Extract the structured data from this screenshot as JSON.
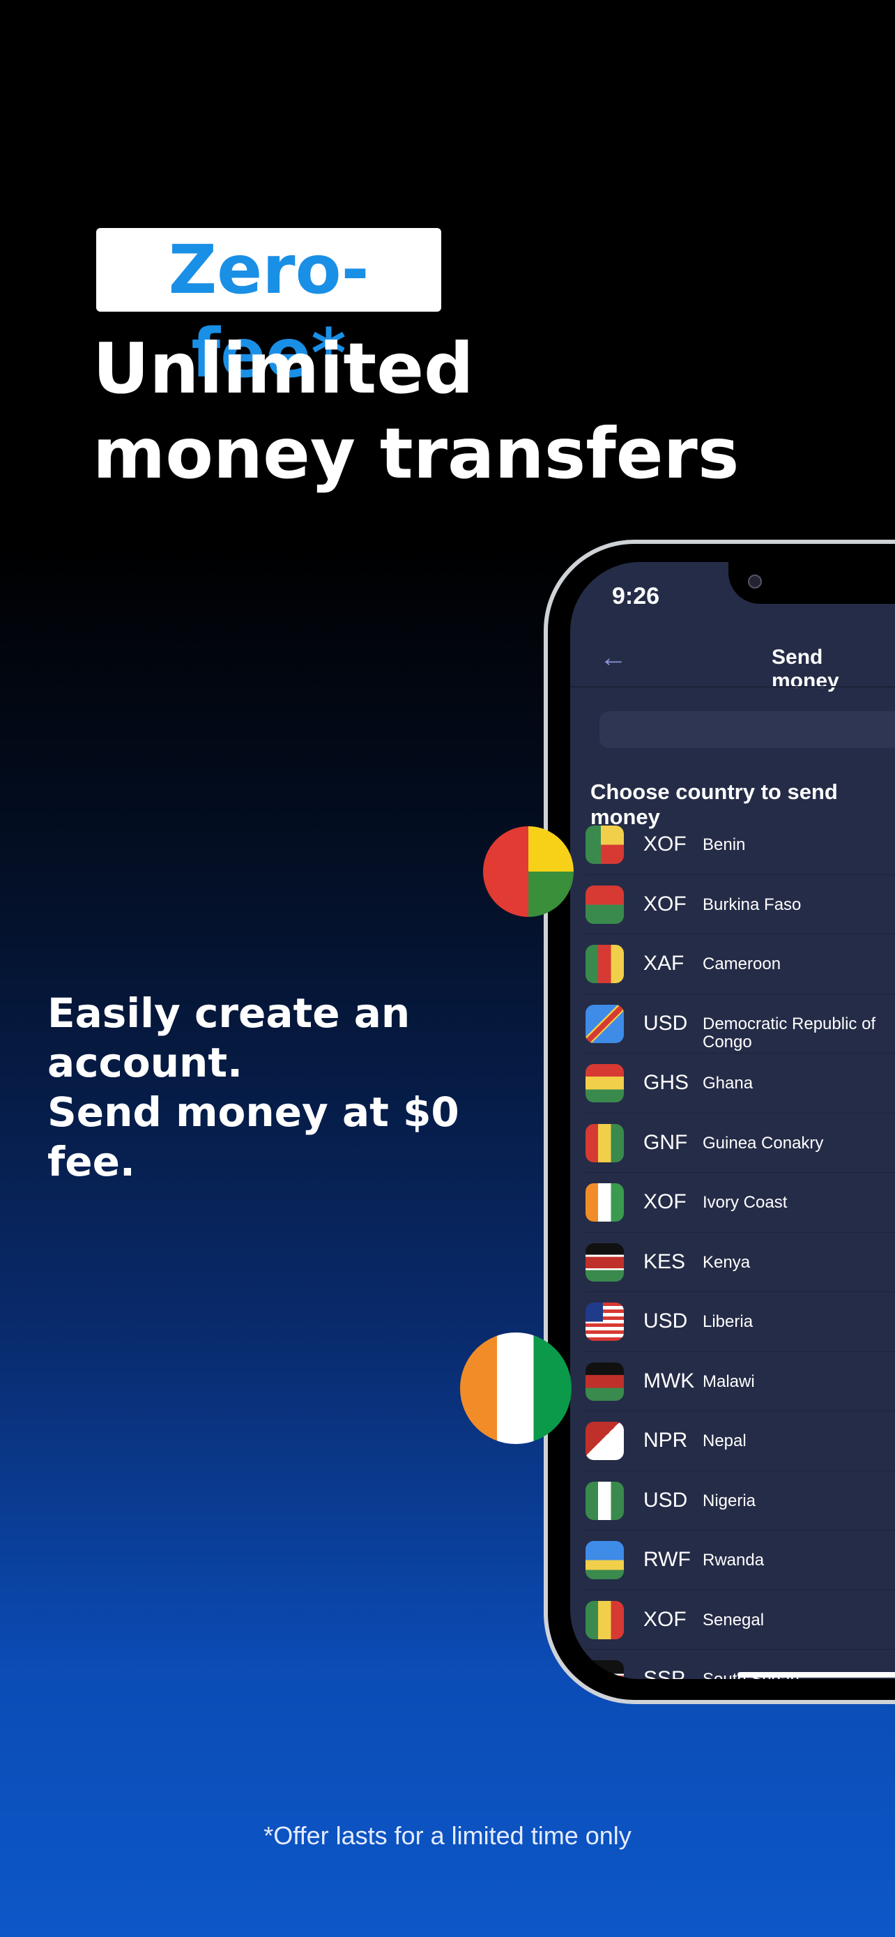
{
  "promo": {
    "badge": "Zero-fee*",
    "headline_line1": "Unlimited",
    "headline_line2": "money transfers",
    "sub_line1": "Easily create an",
    "sub_line2": "account.",
    "sub_line3": "Send money at $0 fee.",
    "footer": "*Offer lasts for a limited time only"
  },
  "phone": {
    "time": "9:26",
    "title": "Send money",
    "back_icon": "arrow-left-icon",
    "search_placeholder": "",
    "section_title": "Choose country to send money",
    "countries": [
      {
        "currency": "XOF",
        "name": "Benin",
        "flag": "linear-gradient(90deg,#3a8a4e 0 40%,transparent 40%),linear-gradient(180deg,#f2cf4a 0 50%,#d63a33 50%)"
      },
      {
        "currency": "XOF",
        "name": "Burkina Faso",
        "flag": "linear-gradient(180deg,#d63a33 0 50%,#3a8a4e 50%)"
      },
      {
        "currency": "XAF",
        "name": "Cameroon",
        "flag": "linear-gradient(90deg,#3a8a4e 0 33%,#d63a33 33% 66%,#f2cf4a 66%)"
      },
      {
        "currency": "USD",
        "name": "Democratic Republic of Congo",
        "flag": "linear-gradient(135deg,#3e8be8 0 42%,#f2cf4a 42% 45%,#d63a33 45% 55%,#f2cf4a 55% 58%,#3e8be8 58%)"
      },
      {
        "currency": "GHS",
        "name": "Ghana",
        "flag": "linear-gradient(180deg,#d63a33 0 33%,#f2cf4a 33% 66%,#3a8a4e 66%)"
      },
      {
        "currency": "GNF",
        "name": "Guinea Conakry",
        "flag": "linear-gradient(90deg,#d63a33 0 33%,#f2cf4a 33% 66%,#3a8a4e 66%)"
      },
      {
        "currency": "XOF",
        "name": "Ivory Coast",
        "flag": "linear-gradient(90deg,#f28c28 0 33%,#fff 33% 66%,#3a9a4e 66%)"
      },
      {
        "currency": "KES",
        "name": "Kenya",
        "flag": "linear-gradient(180deg,#111 0 30%,#fff 30% 35%,#c0302a 35% 65%,#fff 65% 70%,#3a8a4e 70%)"
      },
      {
        "currency": "USD",
        "name": "Liberia",
        "flag": "linear-gradient(90deg,#1f3b8a 0 45%,transparent 45%) 0 0/100% 50% no-repeat,repeating-linear-gradient(180deg,#d63a33 0 5px,#fff 5px 10px)"
      },
      {
        "currency": "MWK",
        "name": "Malawi",
        "flag": "linear-gradient(180deg,#111 0 33%,#c0302a 33% 66%,#3a8a4e 66%)"
      },
      {
        "currency": "NPR",
        "name": "Nepal",
        "flag": "linear-gradient(135deg,#c0302a 0 45%,#fff 45%)"
      },
      {
        "currency": "USD",
        "name": "Nigeria",
        "flag": "linear-gradient(90deg,#3a8a4e 0 33%,#fff 33% 66%,#3a8a4e 66%)"
      },
      {
        "currency": "RWF",
        "name": "Rwanda",
        "flag": "linear-gradient(180deg,#3e8be8 0 50%,#f2cf4a 50% 75%,#3a8a4e 75%)"
      },
      {
        "currency": "XOF",
        "name": "Senegal",
        "flag": "linear-gradient(90deg,#3a8a4e 0 33%,#f2cf4a 33% 66%,#d63a33 66%)"
      },
      {
        "currency": "SSP",
        "name": "South Sudan",
        "flag": "linear-gradient(180deg,#111 0 35%,#fff 35% 40%,#c0302a 40% 60%,#fff 60% 65%,#3a8a4e 65%)"
      }
    ]
  },
  "floating_flags": [
    {
      "name": "Guinea-Bissau",
      "flag": "linear-gradient(90deg,#e23b33 0 50%,transparent 50%),linear-gradient(180deg,#f7d117 0 50%,#3a8f3a 50%)"
    },
    {
      "name": "Ivory Coast",
      "flag": "linear-gradient(90deg,#f28c28 0 33%,#fff 33% 66%,#0a9a4a 66%)"
    }
  ],
  "colors": {
    "accent": "#1a8fe6",
    "screen_bg": "#252c47",
    "bottom_blue": "#0d57c8"
  }
}
